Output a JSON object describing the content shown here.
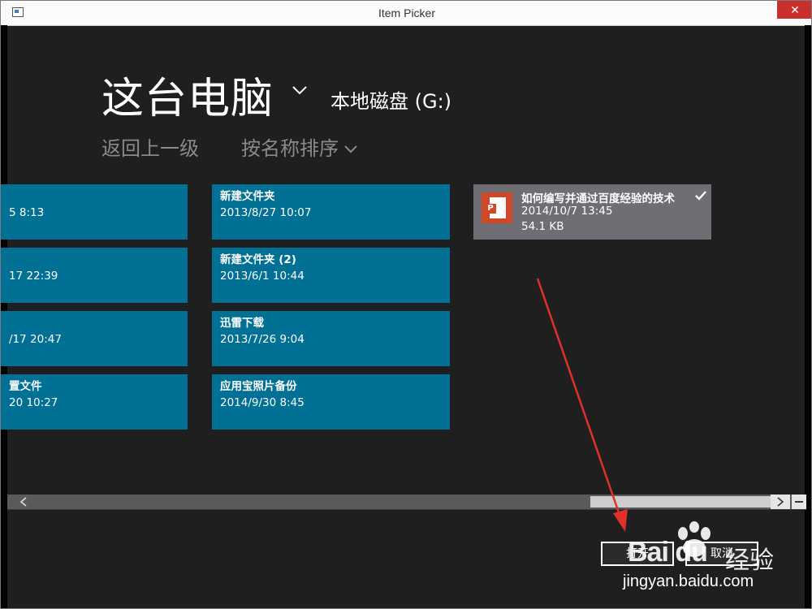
{
  "window": {
    "title": "Item Picker",
    "close_glyph": "✕"
  },
  "header": {
    "location": "这台电脑",
    "drive": "本地磁盘 (G:)",
    "back": "返回上一级",
    "sort": "按名称排序"
  },
  "tiles": [
    {
      "name": "",
      "date": "5 8:13"
    },
    {
      "name": "",
      "date": "17 22:39"
    },
    {
      "name": "",
      "date": "/17 20:47"
    },
    {
      "name": "置文件",
      "date": "20 10:27"
    },
    {
      "name": "新建文件夹",
      "date": "2013/8/27 10:07"
    },
    {
      "name": "新建文件夹 (2)",
      "date": "2013/6/1 10:44"
    },
    {
      "name": "迅雷下载",
      "date": "2013/7/26 9:04"
    },
    {
      "name": "应用宝照片备份",
      "date": "2014/9/30 8:45"
    }
  ],
  "selected_file": {
    "name": "如何编写并通过百度经验的技术",
    "date": "2014/10/7 13:45",
    "size": "54.1 KB",
    "icon": "powerpoint-file-icon",
    "icon_letter": "P"
  },
  "buttons": {
    "open": "打开",
    "cancel": "取消"
  },
  "watermark": {
    "logo": "Bai du",
    "suffix": "经验",
    "url": "jingyan.baidu.com"
  },
  "colors": {
    "tile": "#007095",
    "selected_tile": "#6e6e74",
    "background": "#1f1f1f",
    "arrow": "#e0302a"
  }
}
